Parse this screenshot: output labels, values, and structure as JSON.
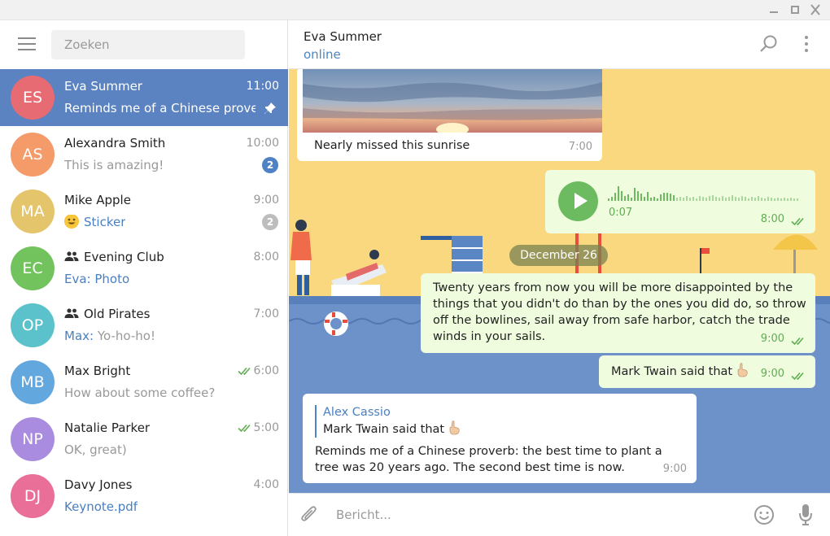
{
  "window": {
    "controls": [
      "minimize",
      "maximize",
      "close"
    ]
  },
  "sidebar": {
    "search_placeholder": "Zoeken",
    "chats": [
      {
        "initials": "ES",
        "name": "Eva Summer",
        "time": "11:00",
        "preview": "Reminds me of a Chinese prove…",
        "avatar_color": "#e66b73",
        "active": true,
        "pinned": true
      },
      {
        "initials": "AS",
        "name": "Alexandra Smith",
        "time": "10:00",
        "preview": "This is amazing!",
        "avatar_color": "#f59a69",
        "badge": "2",
        "badge_color": "#4f82c4"
      },
      {
        "initials": "MA",
        "name": "Mike Apple",
        "time": "9:00",
        "preview": "Sticker",
        "avatar_color": "#e5c56c",
        "badge": "2",
        "badge_color": "#bdbdbd",
        "preview_is_link": true
      },
      {
        "initials": "EC",
        "name": "Evening Club",
        "time": "8:00",
        "preview": "Eva: Photo",
        "avatar_color": "#72c35e",
        "group": true,
        "preview_is_link": true
      },
      {
        "initials": "OP",
        "name": "Old Pirates",
        "time": "7:00",
        "preview_sender": "Max:",
        "preview": "Yo-ho-ho!",
        "avatar_color": "#5bc2cb",
        "group": true
      },
      {
        "initials": "MB",
        "name": "Max Bright",
        "time": "6:00",
        "preview": "How about some coffee?",
        "avatar_color": "#63a7df",
        "read": true
      },
      {
        "initials": "NP",
        "name": "Natalie Parker",
        "time": "5:00",
        "preview": "OK, great)",
        "avatar_color": "#a98ce0",
        "read": true
      },
      {
        "initials": "DJ",
        "name": "Davy Jones",
        "time": "4:00",
        "preview": "Keynote.pdf",
        "avatar_color": "#ea6f98",
        "preview_is_link": true
      }
    ]
  },
  "chat": {
    "peer_name": "Eva Summer",
    "peer_status": "online",
    "messages": {
      "photo_caption": "Nearly missed this sunrise",
      "photo_time": "7:00",
      "voice_duration": "0:07",
      "voice_time": "8:00",
      "date_separator": "December 26",
      "quote_text": "Twenty years from now you will be more disappointed by the things that you didn't do than by the ones you did do, so throw off the bowlines, sail away from safe harbor, catch the trade winds in your sails.",
      "quote_time": "9:00",
      "twain_text": "Mark Twain said that",
      "twain_time": "9:00",
      "reply_name": "Alex Cassio",
      "reply_quote": "Mark Twain said that",
      "reply_text": "Reminds me of a Chinese proverb: the best time to plant a tree was 20 years ago. The second best time is now.",
      "reply_time": "9:00"
    },
    "composer_placeholder": "Bericht..."
  },
  "colors": {
    "accent": "#5b83c1",
    "online": "#4a86c5",
    "outgoing_bubble": "#effdde",
    "check_green": "#5fad52"
  }
}
